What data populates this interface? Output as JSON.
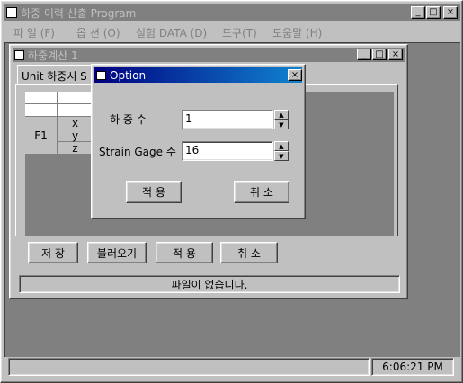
{
  "app": {
    "title": "하중 이력 산출 Program",
    "min": "_",
    "max": "□",
    "close": "×"
  },
  "menu": [
    {
      "label": "파 일 (F)"
    },
    {
      "label": "옵 션 (O)"
    },
    {
      "label": "실험 DATA (D)"
    },
    {
      "label": "도구(T)"
    },
    {
      "label": "도움말 (H)"
    }
  ],
  "child": {
    "title": "하중계산 1",
    "tab_label": "Unit 하중시 S",
    "grid": {
      "row_label": "F1",
      "axes": [
        "x",
        "y",
        "z"
      ]
    },
    "buttons": {
      "save": "저 장",
      "load": "불러오기",
      "apply": "적 용",
      "cancel": "취 소"
    },
    "status": "파일이 없습니다."
  },
  "dialog": {
    "title": "Option",
    "close": "×",
    "load_count_label": "하 중 수",
    "load_count_value": "1",
    "gage_label": "Strain Gage 수",
    "gage_value": "16",
    "apply": "적 용",
    "cancel": "취 소"
  },
  "statusbar": {
    "time": "6:06:21 PM"
  },
  "colors": {
    "active_title": "#000080",
    "inactive_title": "#808080",
    "face": "#c0c0c0",
    "workspace": "#808080"
  }
}
